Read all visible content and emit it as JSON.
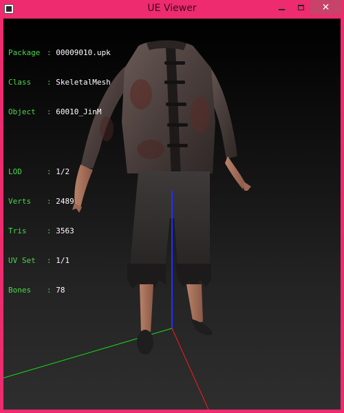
{
  "window": {
    "title": "UE Viewer",
    "close_symbol": "✕"
  },
  "info": {
    "mesh": [
      {
        "label": "Package",
        "value": "00009010.upk"
      },
      {
        "label": "Class",
        "value": "SkeletalMesh"
      },
      {
        "label": "Object",
        "value": "60010_JinM"
      }
    ],
    "stats": [
      {
        "label": "LOD",
        "value": "1/2"
      },
      {
        "label": "Verts",
        "value": "2489"
      },
      {
        "label": "Tris",
        "value": "3563"
      },
      {
        "label": "UV Set",
        "value": "1/1"
      },
      {
        "label": "Bones",
        "value": "78"
      }
    ]
  },
  "colors": {
    "frame": "#ed2b6e",
    "label_green": "#4cd64c",
    "axis_x": "#ff1a1a",
    "axis_y": "#18e018",
    "axis_z": "#2030ff"
  }
}
